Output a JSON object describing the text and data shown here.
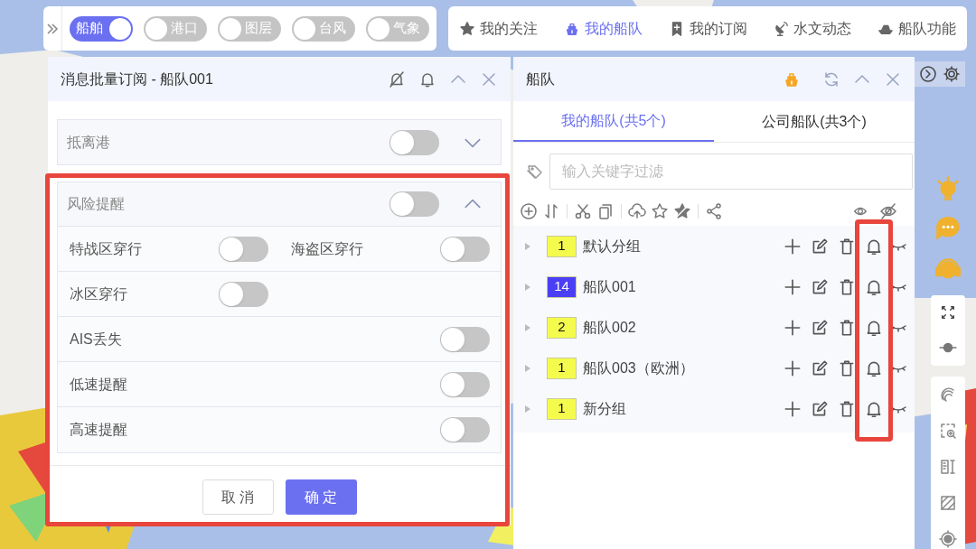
{
  "layer_toggles": [
    {
      "label": "船舶",
      "on": true
    },
    {
      "label": "港口",
      "on": false
    },
    {
      "label": "图层",
      "on": false
    },
    {
      "label": "台风",
      "on": false
    },
    {
      "label": "气象",
      "on": false
    }
  ],
  "top_nav": [
    {
      "label": "我的关注",
      "kind": "star",
      "selected": false
    },
    {
      "label": "我的船队",
      "kind": "ship",
      "selected": true
    },
    {
      "label": "我的订阅",
      "kind": "bookmark",
      "selected": false
    },
    {
      "label": "水文动态",
      "kind": "satellite",
      "selected": false
    },
    {
      "label": "船队功能",
      "kind": "fleet",
      "selected": false
    }
  ],
  "subscribe_panel": {
    "title": "消息批量订阅 - 船队001",
    "sections": [
      {
        "title": "抵离港",
        "on": false,
        "expanded": false
      },
      {
        "title": "风险提醒",
        "on": false,
        "expanded": true,
        "rows": [
          {
            "kind": "pair",
            "cells": [
              {
                "label": "特战区穿行",
                "on": false
              },
              {
                "label": "海盗区穿行",
                "on": false
              }
            ]
          },
          {
            "kind": "pair",
            "cells": [
              {
                "label": "冰区穿行",
                "on": false
              }
            ]
          },
          {
            "kind": "full",
            "cells": [
              {
                "label": "AIS丢失",
                "on": false
              }
            ]
          },
          {
            "kind": "full",
            "cells": [
              {
                "label": "低速提醒",
                "on": false
              }
            ]
          },
          {
            "kind": "full",
            "cells": [
              {
                "label": "高速提醒",
                "on": false
              }
            ]
          }
        ]
      }
    ],
    "buttons": [
      "取 消",
      "确 定"
    ]
  },
  "fleet_panel": {
    "title": "船队",
    "tabs": [
      {
        "label": "我的船队(共5个)",
        "selected": true
      },
      {
        "label": "公司船队(共3个)",
        "selected": false
      }
    ],
    "search": {
      "placeholder": "输入关键字过滤"
    },
    "groups": [
      {
        "count": "1",
        "color": "#f4fb4c",
        "name": "默认分组"
      },
      {
        "count": "14",
        "color": "#4a3ff5",
        "name": "船队001"
      },
      {
        "count": "2",
        "color": "#f4fb4c",
        "name": "船队002"
      },
      {
        "count": "1",
        "color": "#f4fb4c",
        "name": "船队003（欧洲）"
      },
      {
        "count": "1",
        "color": "#f4fb4c",
        "name": "新分组"
      }
    ]
  }
}
